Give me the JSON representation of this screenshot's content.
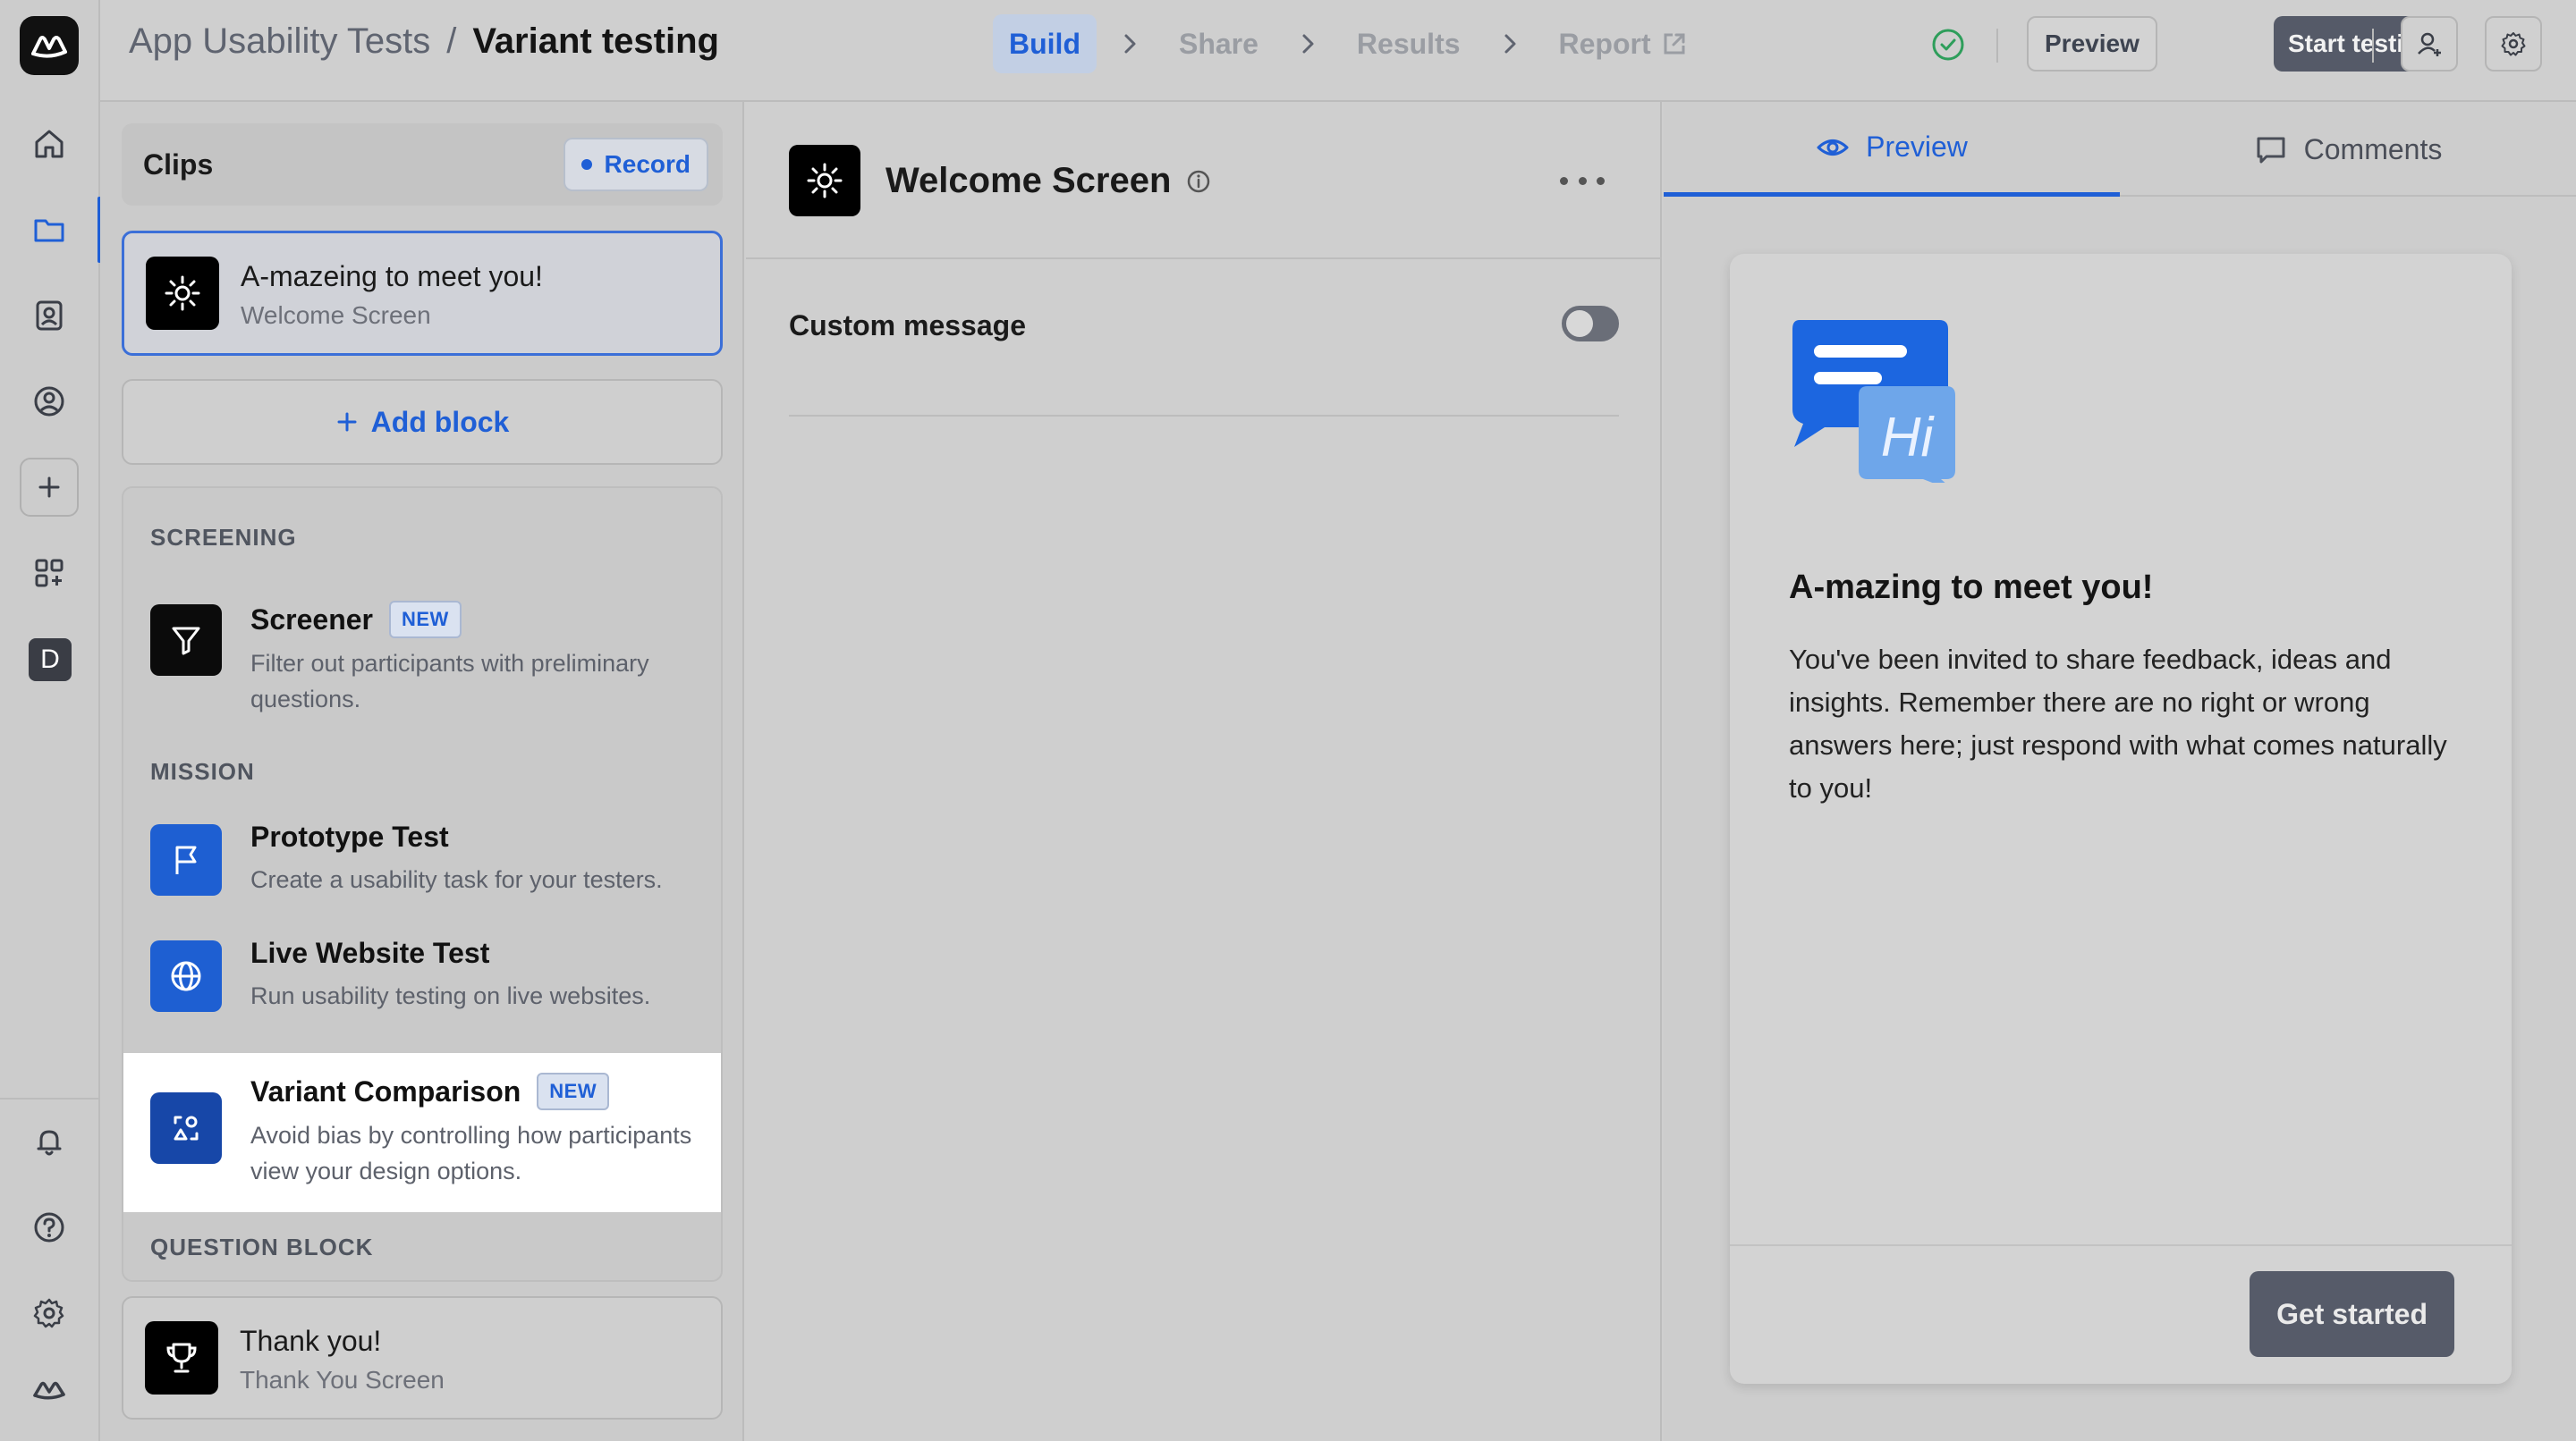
{
  "breadcrumb": {
    "project": "App Usability Tests",
    "separator": "/",
    "current": "Variant testing"
  },
  "steps": [
    {
      "label": "Build",
      "active": true
    },
    {
      "label": "Share",
      "active": false
    },
    {
      "label": "Results",
      "active": false
    },
    {
      "label": "Report",
      "active": false
    }
  ],
  "toolbar": {
    "preview_label": "Preview",
    "start_label": "Start testing"
  },
  "rail": {
    "avatar_letter": "D"
  },
  "clips": {
    "title": "Clips",
    "record_label": "Record",
    "items": [
      {
        "title": "A-mazeing to meet you!",
        "subtitle": "Welcome Screen"
      },
      {
        "title": "Thank you!",
        "subtitle": "Thank You Screen"
      }
    ]
  },
  "add_block_label": "Add block",
  "blocks": {
    "sections": [
      "SCREENING",
      "MISSION",
      "QUESTION BLOCK"
    ],
    "items": [
      {
        "title": "Screener",
        "badge": "NEW",
        "desc": "Filter out participants with preliminary questions."
      },
      {
        "title": "Prototype Test",
        "badge": "",
        "desc": "Create a usability task for your testers."
      },
      {
        "title": "Live Website Test",
        "badge": "",
        "desc": "Run usability testing on live websites."
      },
      {
        "title": "Variant Comparison",
        "badge": "NEW",
        "desc": "Avoid bias by controlling how participants view your design options."
      }
    ]
  },
  "editor": {
    "title": "Welcome Screen",
    "custom_message_label": "Custom message",
    "custom_message_enabled": false
  },
  "right_tabs": {
    "preview": "Preview",
    "comments": "Comments"
  },
  "preview": {
    "illustration_text": "Hi",
    "title": "A-mazing to meet you!",
    "body": "You've been invited to share feedback, ideas and insights. Remember there are no right or wrong answers here; just respond with what comes naturally to you!",
    "cta": "Get started"
  },
  "colors": {
    "accent": "#1f5fd6",
    "dark_button": "#555a68",
    "status_ok": "#2e9e5b"
  }
}
